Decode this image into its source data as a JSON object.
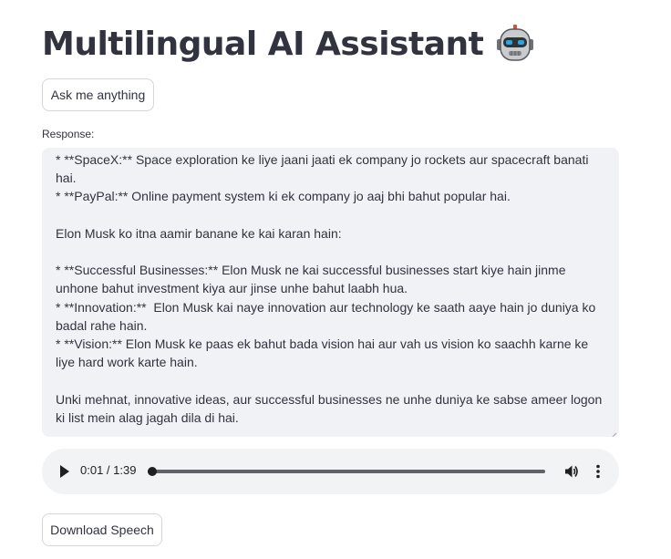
{
  "header": {
    "title": "Multilingual AI Assistant",
    "emoji_icon": "robot-face-icon"
  },
  "ask_button": {
    "label": "Ask me anything"
  },
  "response": {
    "label": "Response:",
    "text": "* **SpaceX:** Space exploration ke liye jaani jaati ek company jo rockets aur spacecraft banati hai.\n* **PayPal:** Online payment system ki ek company jo aaj bhi bahut popular hai.\n\nElon Musk ko itna aamir banane ke kai karan hain:\n\n* **Successful Businesses:** Elon Musk ne kai successful businesses start kiye hain jinme unhone bahut investment kiya aur jinse unhe bahut laabh hua.\n* **Innovation:**  Elon Musk kai naye innovation aur technology ke saath aaye hain jo duniya ko badal rahe hain.\n* **Vision:** Elon Musk ke paas ek bahut bada vision hai aur vah us vision ko saachh karne ke liye hard work karte hain.\n\nUnki mehnat, innovative ideas, aur successful businesses ne unhe duniya ke sabse ameer logon ki list mein alag jagah dila di hai."
  },
  "audio": {
    "time_display": "0:01 / 1:39",
    "progress_fraction": 0.01,
    "play_icon": "play-icon",
    "volume_icon": "volume-icon",
    "more_icon": "more-vertical-icon"
  },
  "download_button": {
    "label": "Download Speech"
  },
  "colors": {
    "text": "#31333f",
    "response_bg": "#f0f2f6",
    "player_bg": "#f1f3f4",
    "button_border": "#d5d6da"
  }
}
